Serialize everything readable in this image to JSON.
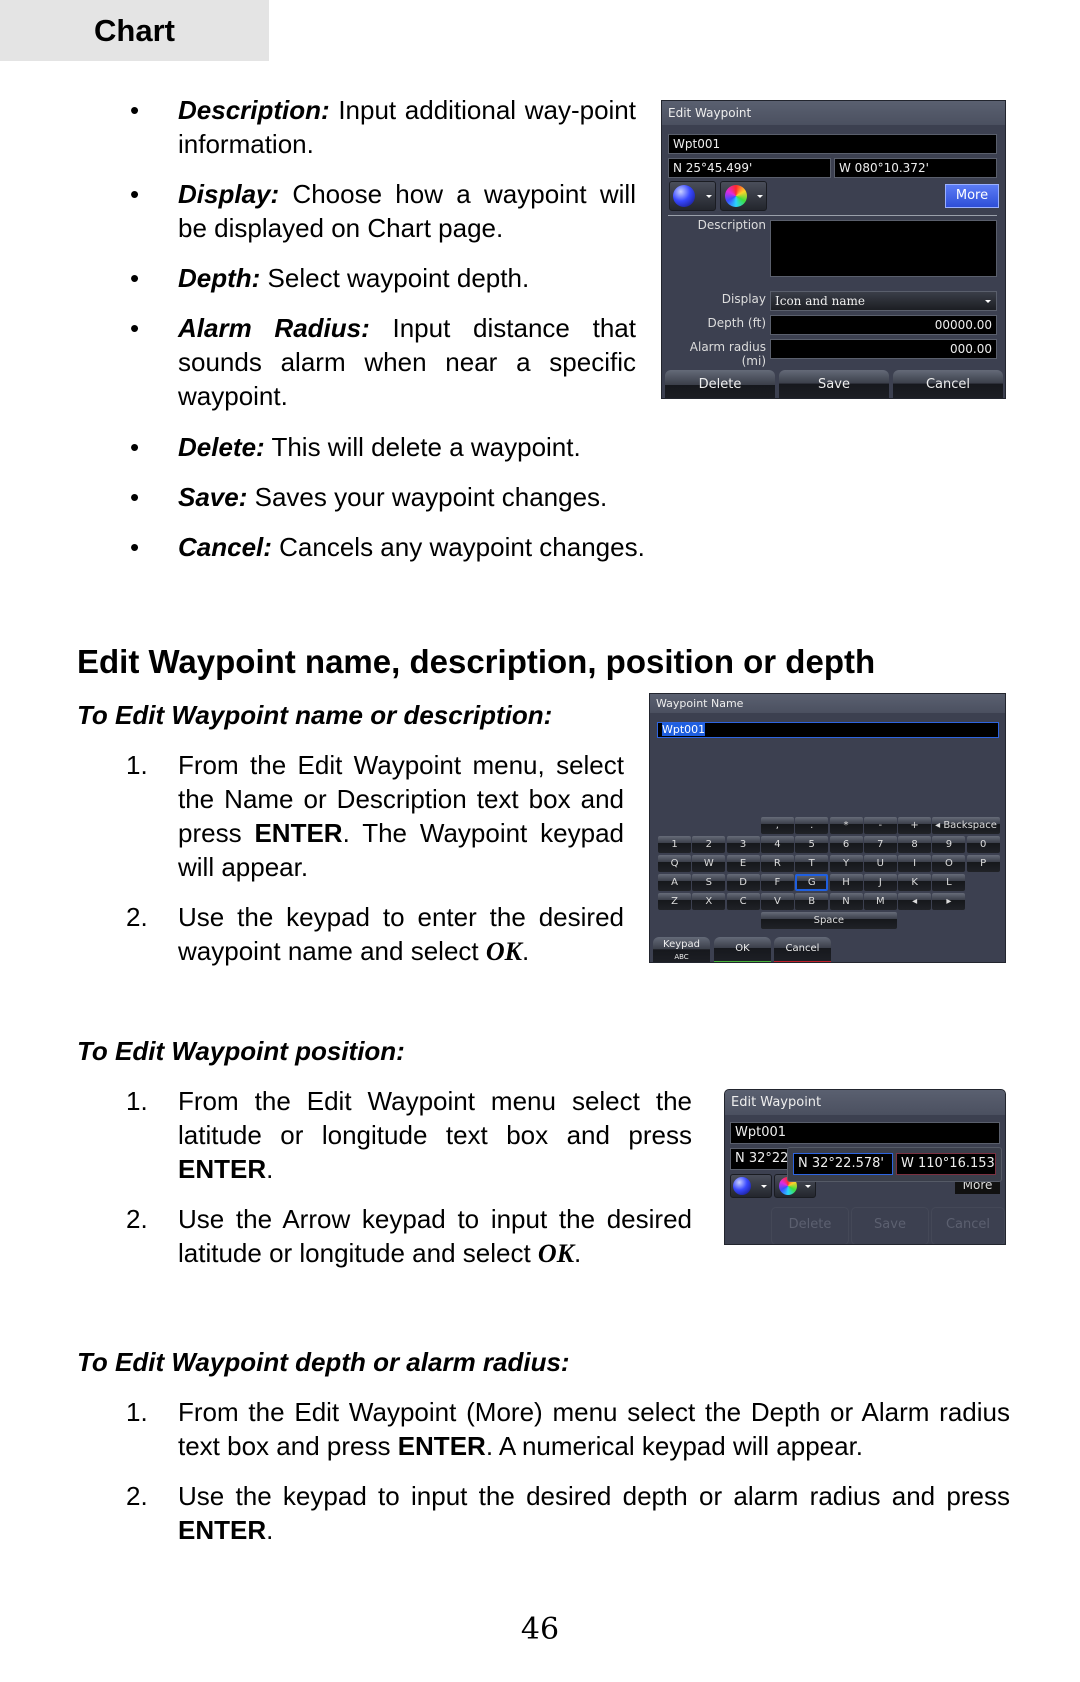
{
  "section_tab": "Chart",
  "bullets": [
    {
      "label": "Description:",
      "text": " Input additional way-point information."
    },
    {
      "label": "Display:",
      "text": " Choose how a waypoint will be displayed on Chart page."
    },
    {
      "label": "Depth:",
      "text": " Select waypoint depth."
    },
    {
      "label": "Alarm Radius:",
      "text": " Input distance that sounds alarm when near a specific waypoint."
    },
    {
      "label": "Delete:",
      "text": " This will delete a waypoint."
    },
    {
      "label": "Save:",
      "text": " Saves your waypoint changes."
    },
    {
      "label": "Cancel:",
      "text": " Cancels any waypoint changes."
    }
  ],
  "bullet_glyph": "•",
  "heading": "Edit Waypoint name, description, position or depth",
  "sec_name": {
    "title": "To Edit Waypoint name or description:",
    "steps": [
      {
        "num": "1.",
        "parts": [
          "From the Edit Waypoint menu, select the Name or Description text box and press ",
          "ENTER",
          ". The Waypoint keypad will appear."
        ]
      },
      {
        "num": "2.",
        "parts": [
          "Use the keypad to enter the desired waypoint name and select ",
          "OK",
          "."
        ]
      }
    ]
  },
  "sec_position": {
    "title": "To Edit Waypoint position:",
    "steps": [
      {
        "num": "1.",
        "parts": [
          "From the Edit Waypoint menu select the latitude or longitude text box and press ",
          "ENTER",
          "."
        ]
      },
      {
        "num": "2.",
        "parts": [
          "Use the Arrow keypad to input the desired latitude or longitude and select ",
          "OK",
          "."
        ]
      }
    ]
  },
  "sec_depth": {
    "title": "To Edit Waypoint depth or alarm radius:",
    "steps": [
      {
        "num": "1.",
        "parts": [
          "From the Edit Waypoint (More) menu select the Depth or Alarm radius text box and press ",
          "ENTER",
          ". A numerical keypad will appear."
        ]
      },
      {
        "num": "2.",
        "parts": [
          "Use the keypad to input the desired depth or alarm radius and press ",
          "ENTER",
          "."
        ]
      }
    ]
  },
  "panel1": {
    "title": "Edit Waypoint",
    "name": "Wpt001",
    "lat": "N 25°45.499'",
    "lon": "W 080°10.372'",
    "more": "More",
    "description_label": "Description",
    "description_value": "",
    "display_label": "Display",
    "display_value": "Icon and name",
    "depth_label": "Depth (ft)",
    "depth_value": "00000.00",
    "alarm_label": "Alarm radius (mi)",
    "alarm_value": "000.00",
    "delete": "Delete",
    "save": "Save",
    "cancel": "Cancel"
  },
  "panel2": {
    "title": "Waypoint Name",
    "value": "Wpt001",
    "row0": [
      ",",
      ".",
      "*",
      "-",
      "+"
    ],
    "backspace": "◂ Backspace",
    "row1": [
      "1",
      "2",
      "3",
      "4",
      "5",
      "6",
      "7",
      "8",
      "9",
      "0"
    ],
    "row2": [
      "Q",
      "W",
      "E",
      "R",
      "T",
      "Y",
      "U",
      "I",
      "O",
      "P"
    ],
    "row3": [
      "A",
      "S",
      "D",
      "F",
      "G",
      "H",
      "J",
      "K",
      "L"
    ],
    "row4": [
      "Z",
      "X",
      "C",
      "V",
      "B",
      "N",
      "M"
    ],
    "left_arrow": "◂",
    "right_arrow": "▸",
    "space": "Space",
    "selected_key": "G",
    "keypad": "Keypad",
    "keypad_mode": "ABC",
    "ok": "OK",
    "cancel": "Cancel"
  },
  "panel3": {
    "title": "Edit Waypoint",
    "name": "Wpt001",
    "lat_behind": "N 32°22",
    "lat": "N 32°22.578'",
    "lon": "W 110°16.153'",
    "more": "More",
    "delete": "Delete",
    "save": "Save",
    "cancel": "Cancel"
  },
  "page_number": "46"
}
